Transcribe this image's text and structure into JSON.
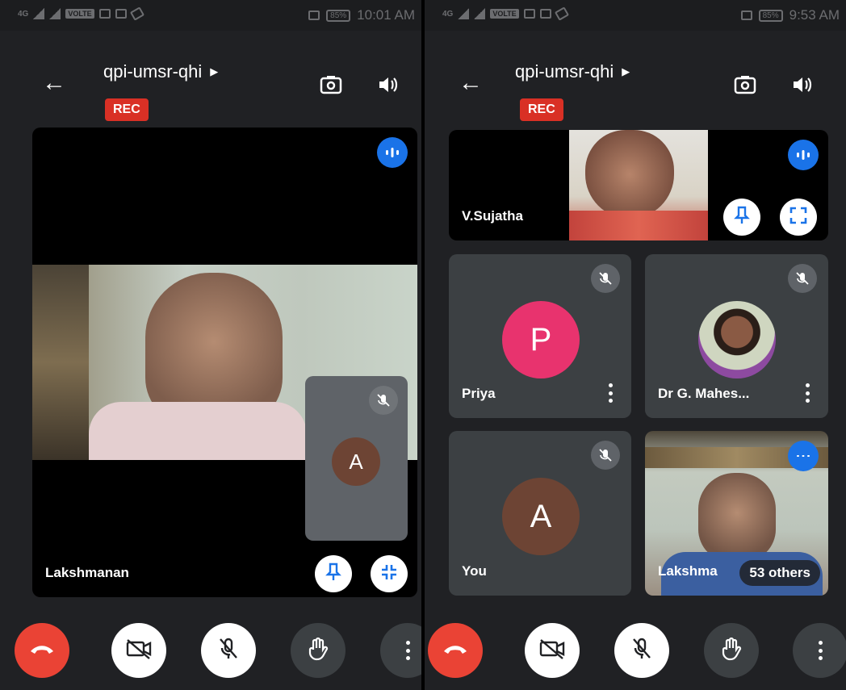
{
  "left": {
    "status": {
      "net1": "4G",
      "volte": "VOLTE",
      "battery": "85%",
      "time": "10:01 AM"
    },
    "header": {
      "title": "qpi-umsr-qhi",
      "rec": "REC"
    },
    "main_tile": {
      "name": "Lakshmanan"
    },
    "self_preview": {
      "initial": "A"
    }
  },
  "right": {
    "status": {
      "net1": "4G",
      "volte": "VOLTE",
      "battery": "85%",
      "time": "9:53 AM"
    },
    "header": {
      "title": "qpi-umsr-qhi",
      "rec": "REC"
    },
    "tiles": {
      "vsujatha": {
        "name": "V.Sujatha"
      },
      "priya": {
        "name": "Priya",
        "initial": "P"
      },
      "mahes": {
        "name": "Dr G. Mahes..."
      },
      "you": {
        "name": "You",
        "initial": "A"
      },
      "lakshmanan": {
        "name": "Lakshma",
        "others": "53 others"
      }
    }
  },
  "colors": {
    "end_call": "#ea4335",
    "rec": "#d93025",
    "active_speaker": "#1a73e8",
    "priya_avatar": "#e8336e",
    "you_avatar": "#6d4434",
    "tile_bg": "#3c4043"
  },
  "icons": [
    "back-arrow-icon",
    "play-triangle-icon",
    "camera-switch-icon",
    "speaker-icon",
    "speaking-indicator-icon",
    "pin-icon",
    "fullscreen-icon",
    "minimize-icon",
    "mic-off-icon",
    "more-vert-icon",
    "end-call-icon",
    "camera-off-icon",
    "raise-hand-icon"
  ]
}
